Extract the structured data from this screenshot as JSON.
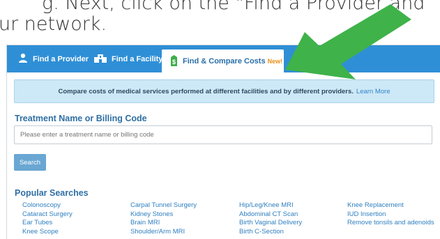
{
  "caption": {
    "line1": "g. Next, click on the \"Find a Provider and",
    "line2": "ur network."
  },
  "tabs": [
    {
      "label": "Find a Provider",
      "icon": "person-icon"
    },
    {
      "label": "Find a Facility",
      "icon": "building-icon"
    },
    {
      "label": "Find & Compare Costs",
      "icon": "price-tag-icon",
      "badge": "New!"
    }
  ],
  "banner": {
    "text": "Compare costs of medical services performed at different facilities and by different providers.",
    "link": "Learn More"
  },
  "treatment": {
    "label": "Treatment Name or Billing Code",
    "placeholder": "Please enter a treatment name or billing code",
    "button": "Search"
  },
  "popular": {
    "label": "Popular Searches",
    "columns": [
      [
        "Colonoscopy",
        "Cataract Surgery",
        "Ear Tubes",
        "Knee Scope"
      ],
      [
        "Carpal Tunnel Surgery",
        "Kidney Stones",
        "Brain MRI",
        "Shoulder/Arm MRI"
      ],
      [
        "Hip/Leg/Knee MRI",
        "Abdominal CT Scan",
        "Birth Vaginal Delivery",
        "Birth C-Section"
      ],
      [
        "Knee Replacement",
        "IUD Insertion",
        "Remove tonsils and adenoids"
      ]
    ]
  },
  "colors": {
    "tab_bar": "#2f8fd6",
    "arrow": "#3fb24a",
    "badge": "#e8901a"
  }
}
